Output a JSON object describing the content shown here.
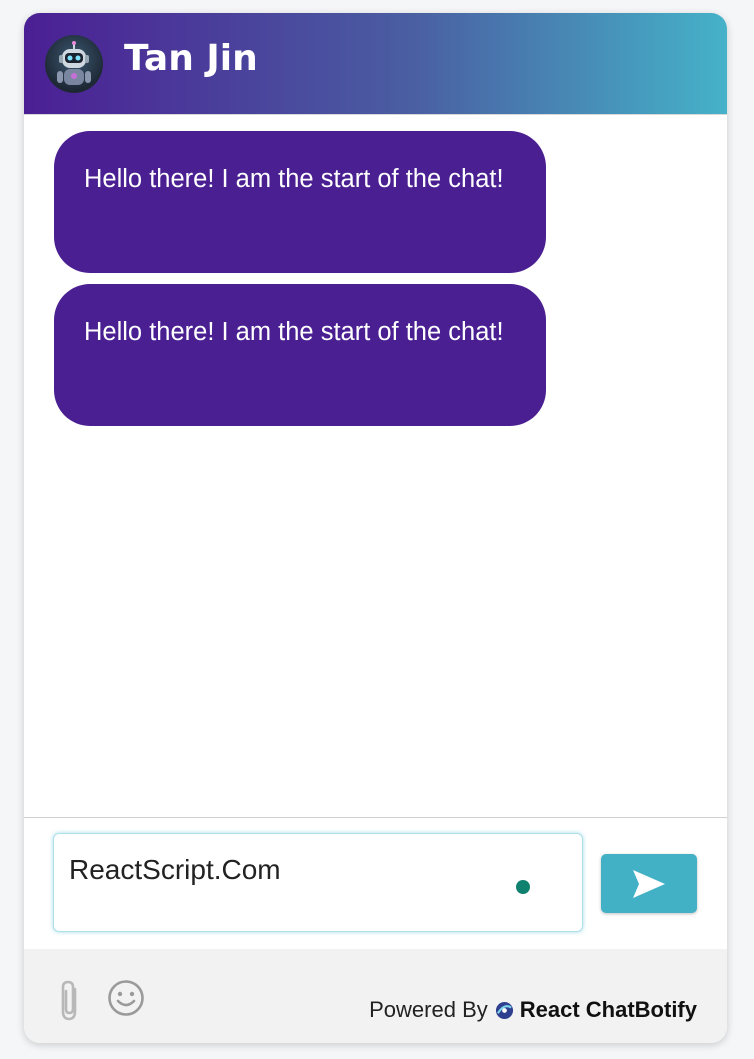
{
  "header": {
    "title": "Tan Jin",
    "avatar_icon": "robot-avatar-icon"
  },
  "messages": [
    {
      "sender": "bot",
      "text": "Hello there! I am the start of the chat!"
    },
    {
      "sender": "bot",
      "text": "Hello there! I am the start of the chat!"
    }
  ],
  "input": {
    "value": "ReactScript.Com",
    "placeholder": ""
  },
  "send_button": {
    "icon": "send-arrow-icon"
  },
  "footer": {
    "attach_icon": "paperclip-icon",
    "emoji_icon": "smiley-icon",
    "powered_by_label": "Powered By",
    "brand_name": "React ChatBotify"
  },
  "colors": {
    "header_gradient_start": "#4b1f94",
    "header_gradient_end": "#45b2c8",
    "bubble_background": "#4a1f92",
    "send_button": "#42b0c5",
    "status_dot": "#10806f"
  }
}
